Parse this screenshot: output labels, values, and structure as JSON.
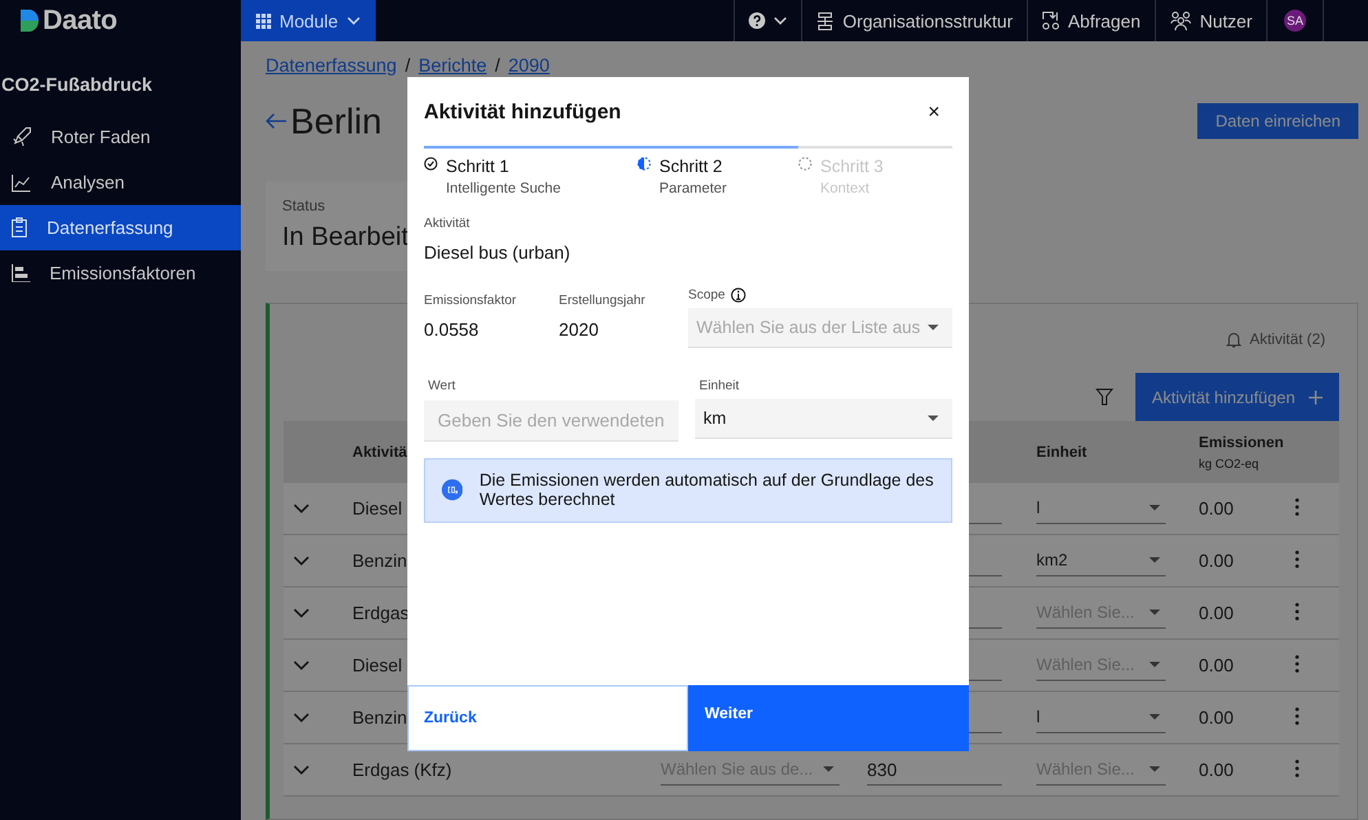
{
  "topbar": {
    "logo": "Daato",
    "module_button": "Module",
    "links": [
      {
        "label": "Organisationsstruktur"
      },
      {
        "label": "Abfragen"
      },
      {
        "label": "Nutzer"
      }
    ],
    "avatar": "SA"
  },
  "sidebar": {
    "heading": "CO2-Fußabdruck",
    "items": [
      {
        "label": "Roter Faden",
        "selected": false
      },
      {
        "label": "Analysen",
        "selected": false
      },
      {
        "label": "Datenerfassung",
        "selected": true
      },
      {
        "label": "Emissionsfaktoren",
        "selected": false
      }
    ]
  },
  "content": {
    "breadcrumb": [
      {
        "kind": "link",
        "text": "Datenerfassung"
      },
      {
        "kind": "separator",
        "text": "/"
      },
      {
        "kind": "link",
        "text": "Berichte"
      },
      {
        "kind": "separator",
        "text": "/"
      },
      {
        "kind": "link",
        "text": "2090"
      }
    ],
    "title": "Berlin",
    "submit_button": "Daten einreichen",
    "status": {
      "label": "Status",
      "value": "In Bearbeit"
    },
    "activity_count": "Aktivität (2)",
    "add_button": "Aktivität hinzufügen",
    "table": {
      "columns": [
        {
          "label": "Aktivitä"
        },
        {
          "label": "Einheit"
        },
        {
          "label": "Emissionen",
          "unit": "kg CO2-eq"
        }
      ],
      "rows": [
        {
          "activity": "Diesel",
          "unit": {
            "value": "l"
          },
          "emissions": "0.00"
        },
        {
          "activity": "Benzin",
          "unit": {
            "value": "km2"
          },
          "emissions": "0.00"
        },
        {
          "activity": "Erdgas",
          "unit": {
            "placeholder": "Wählen Sie..."
          },
          "emissions": "0.00"
        },
        {
          "activity": "Diesel",
          "unit": {
            "placeholder": "Wählen Sie..."
          },
          "emissions": "0.00"
        },
        {
          "activity": "Benzin",
          "unit": {
            "value": "l"
          },
          "emissions": "0.00"
        },
        {
          "activity": "Erdgas (Kfz)",
          "column_3": {
            "placeholder": "Wählen Sie aus de..."
          },
          "column_4": {
            "value": "830"
          },
          "unit": {
            "placeholder": "Wählen Sie..."
          },
          "emissions": "0.00"
        }
      ]
    }
  },
  "modal": {
    "title": "Aktivität hinzufügen",
    "close": "×",
    "steps": [
      {
        "title": "Schritt 1",
        "subtitle": "Intelligente Suche",
        "completed": true,
        "selected": false
      },
      {
        "title": "Schritt 2",
        "subtitle": "Parameter",
        "completed": false,
        "selected": true
      },
      {
        "title": "Schritt 3",
        "subtitle": "Kontext",
        "completed": false,
        "selected": false
      }
    ],
    "activity": {
      "label": "Aktivität",
      "value": "Diesel bus (urban)"
    },
    "emission_factor": {
      "label": "Emissionsfaktor",
      "value": "0.0558"
    },
    "year": {
      "label": "Erstellungsjahr",
      "value": "2020"
    },
    "scope": {
      "label": "Scope",
      "placeholder": "Wählen Sie aus der Liste aus"
    },
    "value_field": {
      "label": "Wert",
      "placeholder": "Geben Sie den verwendeten"
    },
    "unit_field": {
      "label": "Einheit",
      "value": "km"
    },
    "notice": "Die Emissionen werden automatisch auf der Grundlage des Wertes berechnet",
    "back_button": "Zurück",
    "next_button": "Weiter"
  }
}
